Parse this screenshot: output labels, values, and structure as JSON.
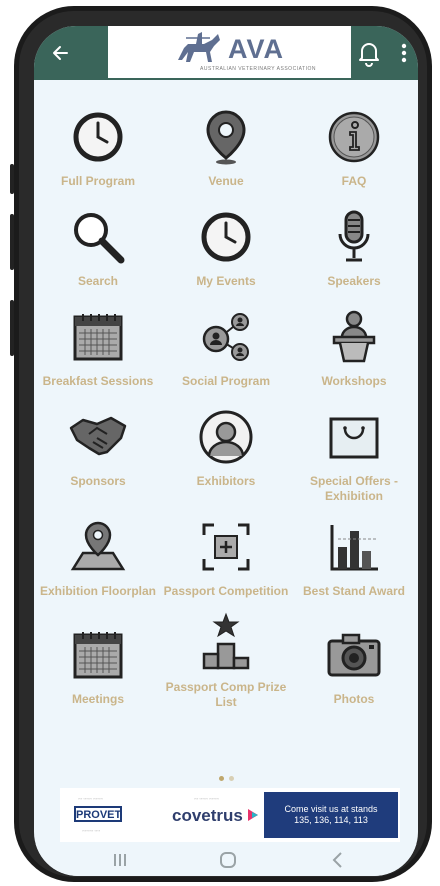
{
  "app_bar": {
    "logo_text": "AVA",
    "logo_subtitle": "AUSTRALIAN VETERINARY ASSOCIATION",
    "colors": {
      "bar": "#3a655a",
      "label": "#cab58a"
    }
  },
  "tiles": [
    {
      "label": "Full Program",
      "icon": "clock-icon"
    },
    {
      "label": "Venue",
      "icon": "map-pin-icon"
    },
    {
      "label": "FAQ",
      "icon": "info-icon"
    },
    {
      "label": "Search",
      "icon": "magnifier-icon"
    },
    {
      "label": "My Events",
      "icon": "clock-icon"
    },
    {
      "label": "Speakers",
      "icon": "microphone-icon"
    },
    {
      "label": "Breakfast Sessions",
      "icon": "calendar-icon"
    },
    {
      "label": "Social Program",
      "icon": "network-icon"
    },
    {
      "label": "Workshops",
      "icon": "podium-speaker-icon"
    },
    {
      "label": "Sponsors",
      "icon": "handshake-icon"
    },
    {
      "label": "Exhibitors",
      "icon": "person-circle-icon"
    },
    {
      "label": "Special Offers - Exhibition",
      "icon": "shopping-bag-icon"
    },
    {
      "label": "Exhibition Floorplan",
      "icon": "map-location-icon"
    },
    {
      "label": "Passport Competition",
      "icon": "add-frame-icon"
    },
    {
      "label": "Best Stand Award",
      "icon": "bar-chart-icon"
    },
    {
      "label": "Meetings",
      "icon": "calendar-icon"
    },
    {
      "label": "Passport Comp Prize List",
      "icon": "star-podium-icon"
    },
    {
      "label": "Photos",
      "icon": "camera-icon"
    }
  ],
  "pager": {
    "current": 1,
    "total": 2
  },
  "sponsors": {
    "provet": "PROVET",
    "covetrus": "covetrus",
    "ad_line1": "Come visit us at stands",
    "ad_line2": "135, 136, 114, 113"
  }
}
